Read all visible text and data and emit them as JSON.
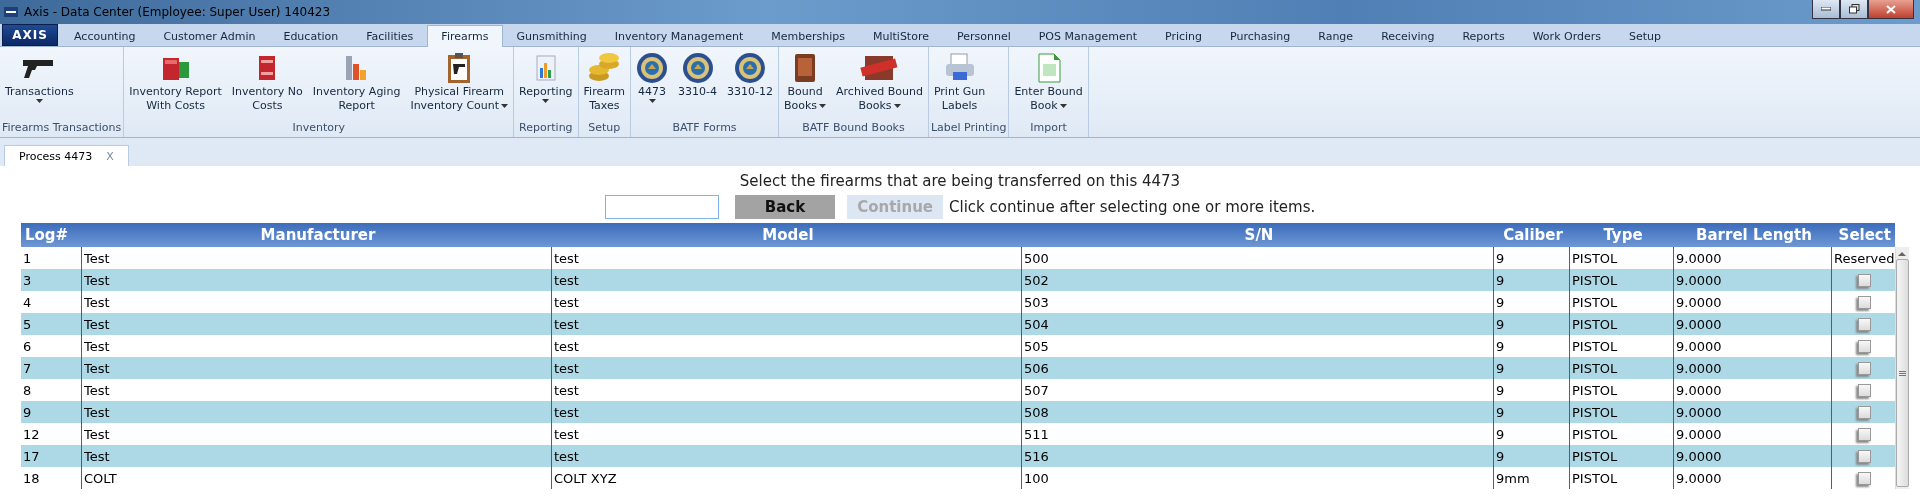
{
  "window": {
    "title": "Axis - Data Center  (Employee: Super User) 140423"
  },
  "app_button": {
    "label": "AXIS"
  },
  "tabs": [
    {
      "label": "Accounting",
      "selected": false
    },
    {
      "label": "Customer Admin",
      "selected": false
    },
    {
      "label": "Education",
      "selected": false
    },
    {
      "label": "Facilities",
      "selected": false
    },
    {
      "label": "Firearms",
      "selected": true
    },
    {
      "label": "Gunsmithing",
      "selected": false
    },
    {
      "label": "Inventory Management",
      "selected": false
    },
    {
      "label": "Memberships",
      "selected": false
    },
    {
      "label": "MultiStore",
      "selected": false
    },
    {
      "label": "Personnel",
      "selected": false
    },
    {
      "label": "POS Management",
      "selected": false
    },
    {
      "label": "Pricing",
      "selected": false
    },
    {
      "label": "Purchasing",
      "selected": false
    },
    {
      "label": "Range",
      "selected": false
    },
    {
      "label": "Receiving",
      "selected": false
    },
    {
      "label": "Reports",
      "selected": false
    },
    {
      "label": "Work Orders",
      "selected": false
    },
    {
      "label": "Setup",
      "selected": false
    }
  ],
  "ribbon_groups": [
    {
      "title": "Firearms Transactions",
      "buttons": [
        {
          "lines": [
            "Transactions"
          ],
          "dropdown": true
        }
      ]
    },
    {
      "title": "Inventory",
      "buttons": [
        {
          "lines": [
            "Inventory Report",
            "With Costs"
          ],
          "dropdown": false
        },
        {
          "lines": [
            "Inventory No",
            "Costs"
          ],
          "dropdown": false
        },
        {
          "lines": [
            "Inventory Aging",
            "Report"
          ],
          "dropdown": false
        },
        {
          "lines": [
            "Physical Firearm",
            "Inventory Count"
          ],
          "dropdown": true
        }
      ]
    },
    {
      "title": "Reporting",
      "buttons": [
        {
          "lines": [
            "Reporting"
          ],
          "dropdown": true
        }
      ]
    },
    {
      "title": "Setup",
      "buttons": [
        {
          "lines": [
            "Firearm",
            "Taxes"
          ],
          "dropdown": false
        }
      ]
    },
    {
      "title": "BATF Forms",
      "buttons": [
        {
          "lines": [
            "4473"
          ],
          "dropdown": true
        },
        {
          "lines": [
            "3310-4"
          ],
          "dropdown": false
        },
        {
          "lines": [
            "3310-12"
          ],
          "dropdown": false
        }
      ]
    },
    {
      "title": "BATF Bound Books",
      "buttons": [
        {
          "lines": [
            "Bound",
            "Books"
          ],
          "dropdown": true
        },
        {
          "lines": [
            "Archived Bound",
            "Books"
          ],
          "dropdown": true
        }
      ]
    },
    {
      "title": "Label Printing",
      "buttons": [
        {
          "lines": [
            "Print Gun",
            "Labels"
          ],
          "dropdown": false
        }
      ]
    },
    {
      "title": "Import",
      "buttons": [
        {
          "lines": [
            "Enter Bound",
            "Book"
          ],
          "dropdown": true
        }
      ]
    }
  ],
  "document_tab": {
    "label": "Process 4473",
    "close": "X"
  },
  "instruction": "Select the firearms that are being transferred on this 4473",
  "back_button": {
    "label": "Back",
    "disabled": false
  },
  "continue_button": {
    "label": "Continue",
    "disabled": true
  },
  "hint": "Click continue after selecting one or more items.",
  "table": {
    "columns": [
      "Log#",
      "Manufacturer",
      "Model",
      "S/N",
      "Caliber",
      "Type",
      "Barrel Length",
      "Select"
    ],
    "rows": [
      {
        "cells": [
          "1",
          "Test",
          "test",
          "500",
          "9",
          "PISTOL",
          "9.0000"
        ],
        "select": {
          "kind": "text",
          "text": "Reserved"
        }
      },
      {
        "cells": [
          "3",
          "Test",
          "test",
          "502",
          "9",
          "PISTOL",
          "9.0000"
        ],
        "select": {
          "kind": "checkbox",
          "checked": false
        }
      },
      {
        "cells": [
          "4",
          "Test",
          "test",
          "503",
          "9",
          "PISTOL",
          "9.0000"
        ],
        "select": {
          "kind": "checkbox",
          "checked": false
        }
      },
      {
        "cells": [
          "5",
          "Test",
          "test",
          "504",
          "9",
          "PISTOL",
          "9.0000"
        ],
        "select": {
          "kind": "checkbox",
          "checked": false
        }
      },
      {
        "cells": [
          "6",
          "Test",
          "test",
          "505",
          "9",
          "PISTOL",
          "9.0000"
        ],
        "select": {
          "kind": "checkbox",
          "checked": false
        }
      },
      {
        "cells": [
          "7",
          "Test",
          "test",
          "506",
          "9",
          "PISTOL",
          "9.0000"
        ],
        "select": {
          "kind": "checkbox",
          "checked": false
        }
      },
      {
        "cells": [
          "8",
          "Test",
          "test",
          "507",
          "9",
          "PISTOL",
          "9.0000"
        ],
        "select": {
          "kind": "checkbox",
          "checked": false
        }
      },
      {
        "cells": [
          "9",
          "Test",
          "test",
          "508",
          "9",
          "PISTOL",
          "9.0000"
        ],
        "select": {
          "kind": "checkbox",
          "checked": false
        }
      },
      {
        "cells": [
          "12",
          "Test",
          "test",
          "511",
          "9",
          "PISTOL",
          "9.0000"
        ],
        "select": {
          "kind": "checkbox",
          "checked": false
        }
      },
      {
        "cells": [
          "17",
          "Test",
          "test",
          "516",
          "9",
          "PISTOL",
          "9.0000"
        ],
        "select": {
          "kind": "checkbox",
          "checked": false
        }
      },
      {
        "cells": [
          "18",
          "COLT",
          "COLT XYZ",
          "100",
          "9mm",
          "PISTOL",
          "9.0000"
        ],
        "select": {
          "kind": "checkbox",
          "checked": false
        }
      }
    ]
  }
}
